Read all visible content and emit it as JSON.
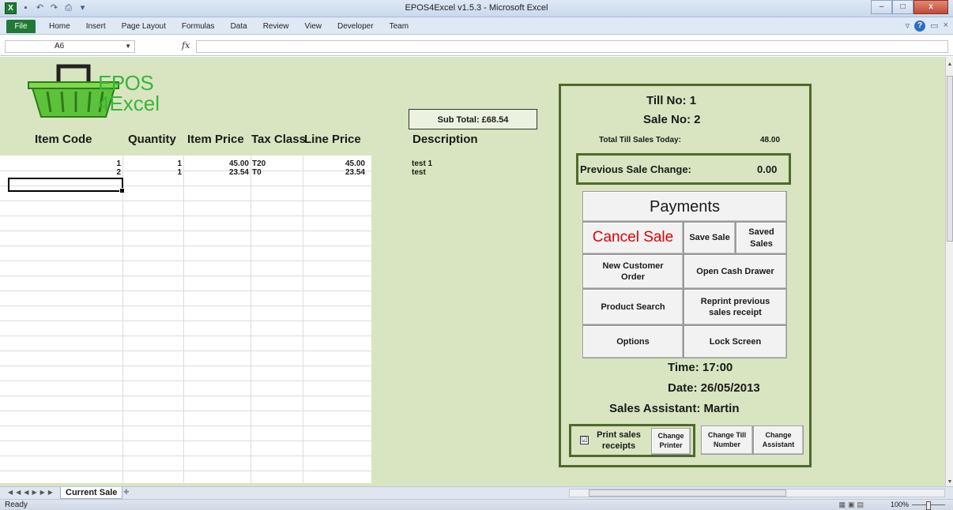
{
  "window": {
    "title": "EPOS4Excel v1.5.3  -  Microsoft Excel",
    "minimize": "–",
    "maximize": "□",
    "close": "x"
  },
  "ribbon": {
    "file_label": "File",
    "tabs": [
      "Home",
      "Insert",
      "Page Layout",
      "Formulas",
      "Data",
      "Review",
      "View",
      "Developer",
      "Team"
    ]
  },
  "formula_bar": {
    "name_box": "A6",
    "fx": "fx",
    "value": ""
  },
  "logo": {
    "line1": "EPOS",
    "line2": "4Excel"
  },
  "columns": {
    "item_code": "Item Code",
    "quantity": "Quantity",
    "item_price": "Item Price",
    "tax_class": "Tax Class",
    "line_price": "Line Price",
    "description": "Description"
  },
  "rows": [
    {
      "item_code": "1",
      "quantity": "1",
      "item_price": "45.00",
      "tax_class": "T20",
      "line_price": "45.00",
      "description": "test 1"
    },
    {
      "item_code": "2",
      "quantity": "1",
      "item_price": "23.54",
      "tax_class": "T0",
      "line_price": "23.54",
      "description": "test"
    }
  ],
  "sub_total": "Sub Total: £68.54",
  "panel": {
    "till_no": "Till No: 1",
    "sale_no": "Sale No: 2",
    "total_sales_label": "Total Till Sales Today:",
    "total_sales_value": "48.00",
    "prev_change_label": "Previous Sale Change:",
    "prev_change_value": "0.00",
    "buttons": {
      "payments": "Payments",
      "cancel_sale": "Cancel Sale",
      "save_sale": "Save Sale",
      "saved_sales": "Saved Sales",
      "new_customer_order": "New Customer Order",
      "open_cash_drawer": "Open Cash Drawer",
      "product_search": "Product Search",
      "reprint_receipt": "Reprint previous sales receipt",
      "options": "Options",
      "lock_screen": "Lock Screen",
      "change_printer": "Change Printer",
      "change_till_number": "Change Till Number",
      "change_assistant": "Change Assistant"
    },
    "time": "Time: 17:00",
    "date": "Date: 26/05/2013",
    "sales_assistant": "Sales Assistant: Martin",
    "print_receipts_label": "Print sales receipts",
    "print_receipts_checked": "☑"
  },
  "sheet_tabs": {
    "active": "Current Sale"
  },
  "status": {
    "ready": "Ready",
    "zoom": "100%"
  },
  "colors": {
    "sheet_bg": "#d8e5c0",
    "panel_border": "#4e6a2b",
    "logo_green": "#39b53a",
    "cancel_red": "#e00000"
  }
}
